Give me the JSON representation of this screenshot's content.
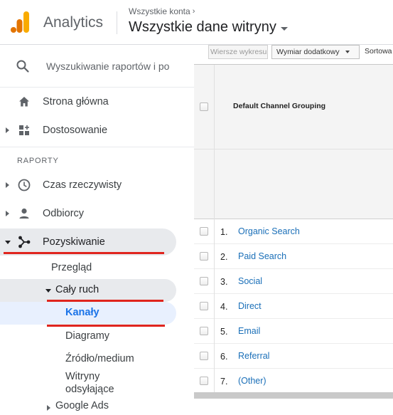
{
  "header": {
    "app_name": "Analytics",
    "account_label": "Wszystkie konta",
    "property_name": "Wszystkie dane witryny",
    "logo_colors": [
      "#f9ab00",
      "#e37400",
      "#e37400"
    ]
  },
  "sidebar": {
    "search_placeholder": "Wyszukiwanie raportów i po",
    "home": "Strona główna",
    "customization": "Dostosowanie",
    "section_reports": "RAPORTY",
    "realtime": "Czas rzeczywisty",
    "audience": "Odbiorcy",
    "acquisition": "Pozyskiwanie",
    "acquisition_children": {
      "overview": "Przegląd",
      "all_traffic": "Cały ruch",
      "channels": "Kanały",
      "treemaps": "Diagramy",
      "source_medium": "Źródło/medium",
      "referrals": "Witryny odsyłające",
      "google_ads": "Google Ads"
    },
    "highlight_color": "#e0251e",
    "selected_color": "#1a73e8"
  },
  "toolbar": {
    "plot_rows": "Wiersze wykresu",
    "secondary_dimension": "Wymiar dodatkowy",
    "sort": "Sortowa"
  },
  "table": {
    "column_header": "Default Channel Grouping",
    "rows": [
      {
        "index": "1.",
        "label": "Organic Search"
      },
      {
        "index": "2.",
        "label": "Paid Search"
      },
      {
        "index": "3.",
        "label": "Social"
      },
      {
        "index": "4.",
        "label": "Direct"
      },
      {
        "index": "5.",
        "label": "Email"
      },
      {
        "index": "6.",
        "label": "Referral"
      },
      {
        "index": "7.",
        "label": "(Other)"
      }
    ]
  }
}
